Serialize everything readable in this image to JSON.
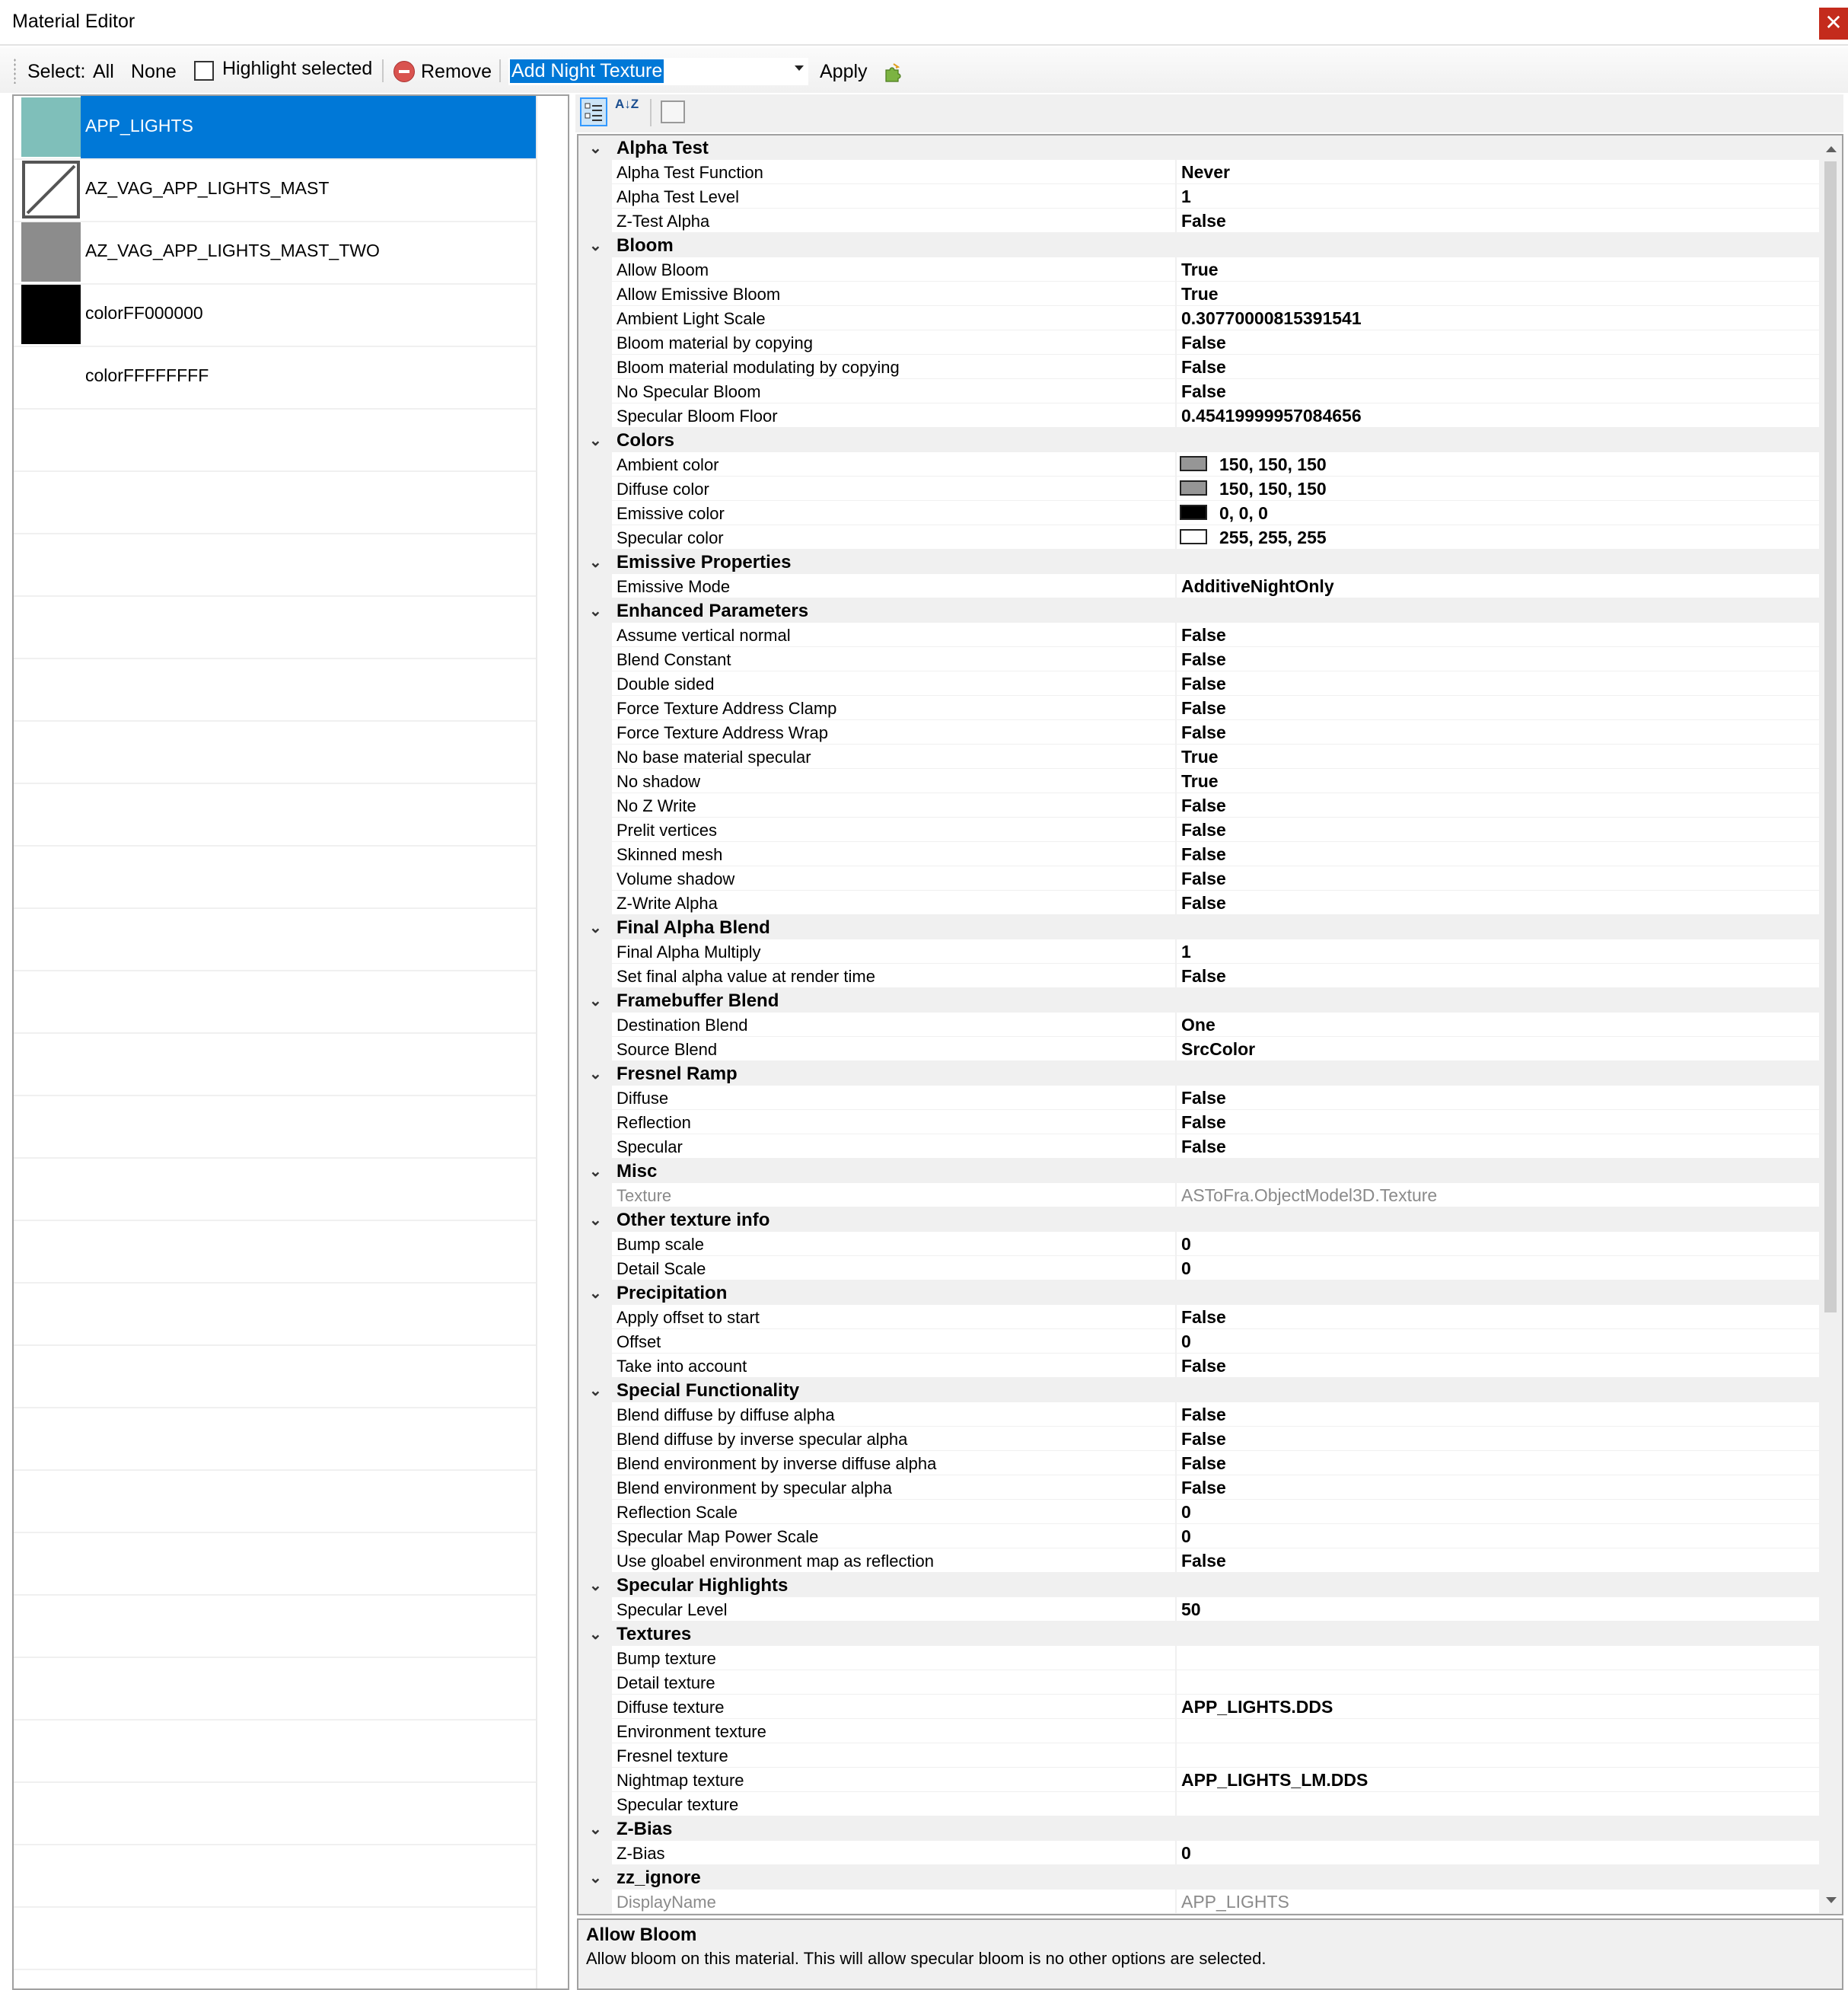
{
  "window": {
    "title": "Material Editor",
    "close_glyph": "✕"
  },
  "toolbar": {
    "select_label": "Select:",
    "all_label": "All",
    "none_label": "None",
    "highlight_label": "Highlight selected",
    "remove_label": "Remove",
    "combo_value": "Add Night Texture",
    "apply_label": "Apply"
  },
  "materials": [
    {
      "name": "APP_LIGHTS",
      "thumb": "#7fbfba",
      "selected": true
    },
    {
      "name": "AZ_VAG_APP_LIGHTS_MAST",
      "thumb": "slash",
      "selected": false
    },
    {
      "name": "AZ_VAG_APP_LIGHTS_MAST_TWO",
      "thumb": "#8c8c8c",
      "selected": false
    },
    {
      "name": "colorFF000000",
      "thumb": "#000000",
      "selected": false
    },
    {
      "name": "colorFFFFFFFF",
      "thumb": "#ffffff",
      "selected": false
    }
  ],
  "property_grid": {
    "az_icon_text": "A↓Z",
    "categories": [
      {
        "name": "Alpha Test",
        "props": [
          {
            "name": "Alpha Test Function",
            "value": "Never"
          },
          {
            "name": "Alpha Test Level",
            "value": "1"
          },
          {
            "name": "Z-Test Alpha",
            "value": "False"
          }
        ]
      },
      {
        "name": "Bloom",
        "props": [
          {
            "name": "Allow Bloom",
            "value": "True"
          },
          {
            "name": "Allow Emissive Bloom",
            "value": "True"
          },
          {
            "name": "Ambient Light Scale",
            "value": "0.30770000815391541"
          },
          {
            "name": "Bloom material by copying",
            "value": "False"
          },
          {
            "name": "Bloom material modulating by copying",
            "value": "False"
          },
          {
            "name": "No Specular Bloom",
            "value": "False"
          },
          {
            "name": "Specular Bloom Floor",
            "value": "0.45419999957084656"
          }
        ]
      },
      {
        "name": "Colors",
        "props": [
          {
            "name": "Ambient color",
            "value": "150, 150, 150",
            "swatch": "#969696"
          },
          {
            "name": "Diffuse color",
            "value": "150, 150, 150",
            "swatch": "#969696"
          },
          {
            "name": "Emissive color",
            "value": "0, 0, 0",
            "swatch": "#000000"
          },
          {
            "name": "Specular color",
            "value": "255, 255, 255",
            "swatch": "#ffffff"
          }
        ]
      },
      {
        "name": "Emissive Properties",
        "props": [
          {
            "name": "Emissive Mode",
            "value": "AdditiveNightOnly"
          }
        ]
      },
      {
        "name": "Enhanced Parameters",
        "props": [
          {
            "name": "Assume vertical normal",
            "value": "False"
          },
          {
            "name": "Blend Constant",
            "value": "False"
          },
          {
            "name": "Double sided",
            "value": "False"
          },
          {
            "name": "Force Texture Address Clamp",
            "value": "False"
          },
          {
            "name": "Force Texture Address Wrap",
            "value": "False"
          },
          {
            "name": "No base material specular",
            "value": "True"
          },
          {
            "name": "No shadow",
            "value": "True"
          },
          {
            "name": "No Z Write",
            "value": "False"
          },
          {
            "name": "Prelit vertices",
            "value": "False"
          },
          {
            "name": "Skinned mesh",
            "value": "False"
          },
          {
            "name": "Volume shadow",
            "value": "False"
          },
          {
            "name": "Z-Write Alpha",
            "value": "False"
          }
        ]
      },
      {
        "name": "Final Alpha Blend",
        "props": [
          {
            "name": "Final Alpha Multiply",
            "value": "1"
          },
          {
            "name": "Set final alpha value at render time",
            "value": "False"
          }
        ]
      },
      {
        "name": "Framebuffer Blend",
        "props": [
          {
            "name": "Destination Blend",
            "value": "One"
          },
          {
            "name": "Source Blend",
            "value": "SrcColor"
          }
        ]
      },
      {
        "name": "Fresnel Ramp",
        "props": [
          {
            "name": "Diffuse",
            "value": "False"
          },
          {
            "name": "Reflection",
            "value": "False"
          },
          {
            "name": "Specular",
            "value": "False"
          }
        ]
      },
      {
        "name": "Misc",
        "props": [
          {
            "name": "Texture",
            "value": "ASToFra.ObjectModel3D.Texture",
            "readonly": true
          }
        ]
      },
      {
        "name": "Other texture info",
        "props": [
          {
            "name": "Bump scale",
            "value": "0"
          },
          {
            "name": "Detail Scale",
            "value": "0"
          }
        ]
      },
      {
        "name": "Precipitation",
        "props": [
          {
            "name": "Apply offset to start",
            "value": "False"
          },
          {
            "name": "Offset",
            "value": "0"
          },
          {
            "name": "Take into account",
            "value": "False"
          }
        ]
      },
      {
        "name": "Special Functionality",
        "props": [
          {
            "name": "Blend diffuse by diffuse alpha",
            "value": "False"
          },
          {
            "name": "Blend diffuse by inverse specular alpha",
            "value": "False"
          },
          {
            "name": "Blend environment by inverse diffuse alpha",
            "value": "False"
          },
          {
            "name": "Blend environment by specular alpha",
            "value": "False"
          },
          {
            "name": "Reflection Scale",
            "value": "0"
          },
          {
            "name": "Specular Map Power Scale",
            "value": "0"
          },
          {
            "name": "Use gloabel environment map as reflection",
            "value": "False"
          }
        ]
      },
      {
        "name": "Specular Highlights",
        "props": [
          {
            "name": "Specular Level",
            "value": "50"
          }
        ]
      },
      {
        "name": "Textures",
        "props": [
          {
            "name": "Bump texture",
            "value": ""
          },
          {
            "name": "Detail texture",
            "value": ""
          },
          {
            "name": "Diffuse texture",
            "value": "APP_LIGHTS.DDS"
          },
          {
            "name": "Environment texture",
            "value": ""
          },
          {
            "name": "Fresnel texture",
            "value": ""
          },
          {
            "name": "Nightmap texture",
            "value": "APP_LIGHTS_LM.DDS"
          },
          {
            "name": "Specular texture",
            "value": ""
          }
        ]
      },
      {
        "name": "Z-Bias",
        "props": [
          {
            "name": "Z-Bias",
            "value": "0"
          }
        ]
      },
      {
        "name": "zz_ignore",
        "props": [
          {
            "name": "DisplayName",
            "value": "APP_LIGHTS",
            "readonly": true
          }
        ]
      }
    ]
  },
  "help": {
    "title": "Allow Bloom",
    "description": "Allow bloom on this material. This will allow specular bloom is no other options are selected."
  }
}
